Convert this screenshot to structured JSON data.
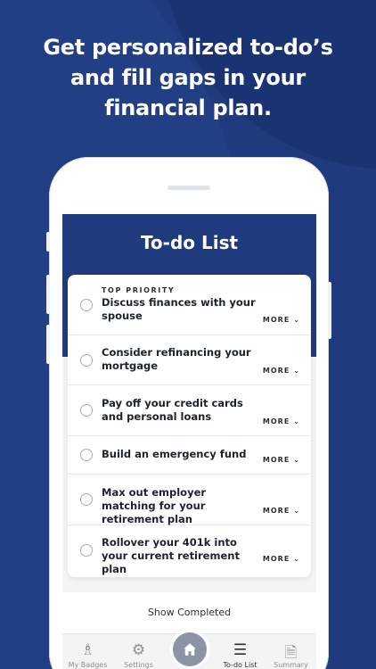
{
  "headline": "Get personalized to-do’s and fill gaps in your financial plan.",
  "screen": {
    "title": "To-do List",
    "more_label": "MORE",
    "items": [
      {
        "kicker": "TOP PRIORITY",
        "text": "Discuss finances with your spouse"
      },
      {
        "kicker": "",
        "text": "Consider refinancing your mortgage"
      },
      {
        "kicker": "",
        "text": "Pay off your credit cards and personal loans"
      },
      {
        "kicker": "",
        "text": "Build an emergency fund"
      },
      {
        "kicker": "",
        "text": "Max out employer matching for your retirement plan"
      },
      {
        "kicker": "",
        "text": "Rollover your 401k into your current retirement plan"
      }
    ],
    "show_completed": "Show Completed"
  },
  "tabbar": {
    "tabs": [
      {
        "label": "My Badges",
        "icon": "badge-icon"
      },
      {
        "label": "Settings",
        "icon": "gear-icon"
      },
      {
        "label": "",
        "icon": "home-icon"
      },
      {
        "label": "To-do List",
        "icon": "checklist-icon"
      },
      {
        "label": "Summary",
        "icon": "document-icon"
      }
    ]
  },
  "colors": {
    "background": "#1f3a7d",
    "header": "#1f3a7d",
    "home_button": "#8b93a4"
  }
}
